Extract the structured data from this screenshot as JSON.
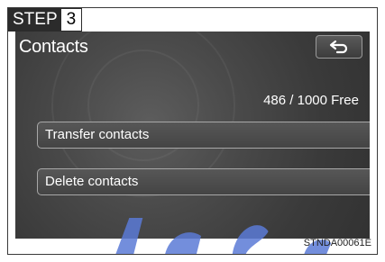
{
  "step": {
    "word": "STEP",
    "number": "3"
  },
  "screen": {
    "title": "Contacts",
    "back_icon": "return-arrow-icon",
    "free_count": "486 / 1000 Free",
    "buttons": [
      {
        "label": "Transfer contacts"
      },
      {
        "label": "Delete contacts"
      }
    ]
  },
  "figure_code": "STNDA00061E",
  "colors": {
    "screen_bg": "#4a4a4a",
    "button_border": "#a8a8a8",
    "watermark": "#5a7ad6"
  }
}
